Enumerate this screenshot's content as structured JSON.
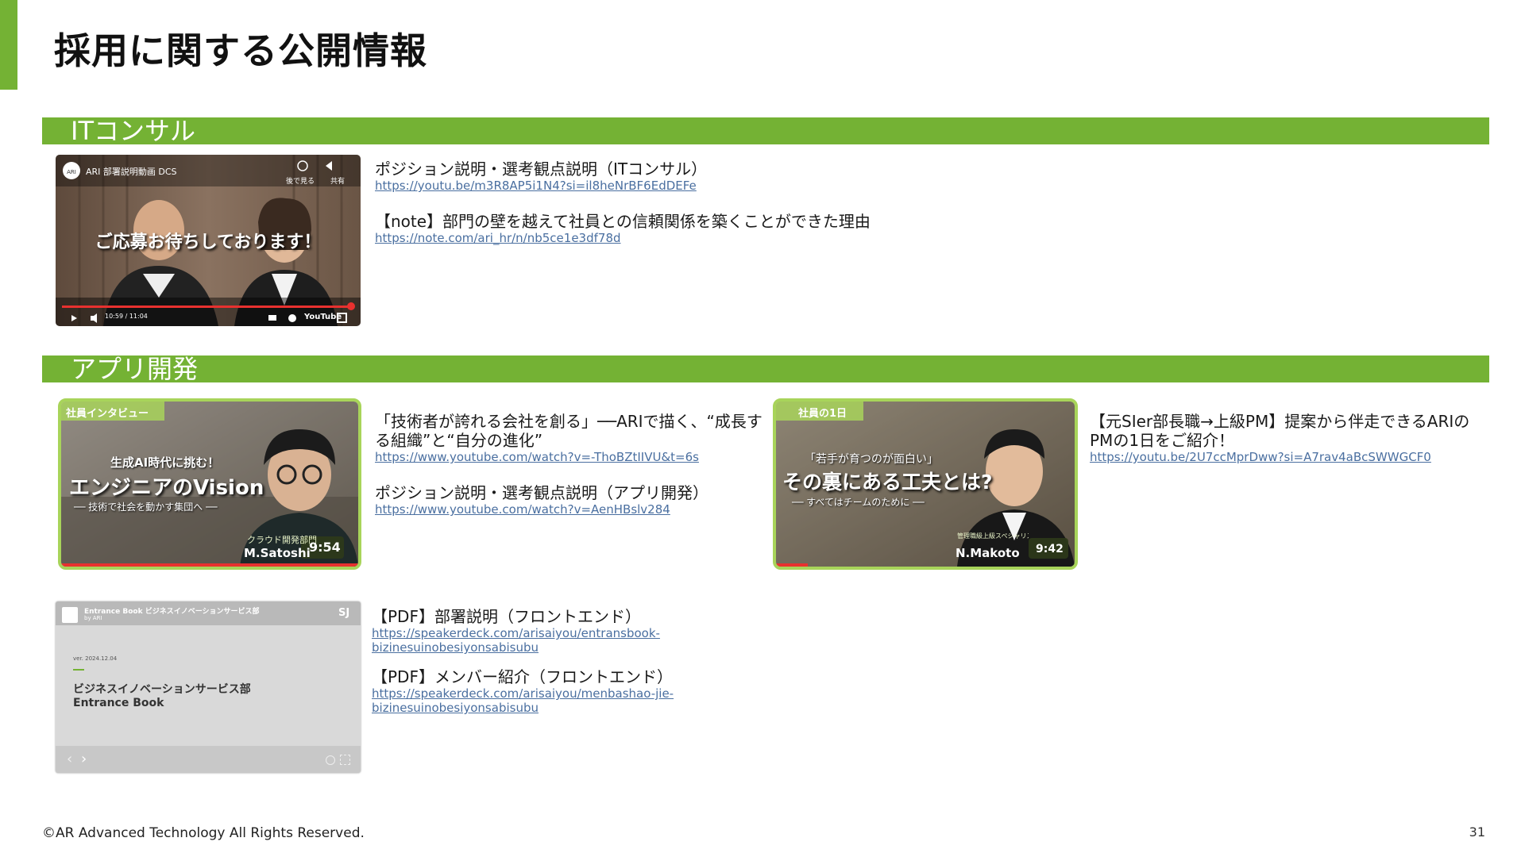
{
  "page": {
    "title": "採用に関する公開情報",
    "footer": "©AR Advanced Technology All Rights Reserved.",
    "page_number": "31"
  },
  "colors": {
    "accent": "#74b234",
    "link": "#4a6fa0"
  },
  "sections": [
    {
      "label": "ITコンサル"
    },
    {
      "label": "アプリ開発"
    }
  ],
  "it_consult": {
    "video": {
      "channel": "ARI 部署説明動画 DCS",
      "watch_later": "後で見る",
      "share": "共有",
      "caption": "ご応募お待ちしております！",
      "time": "10:59 / 11:04",
      "youtube": "YouTube",
      "progress": 0.99
    },
    "links": [
      {
        "title": "ポジション説明・選考観点説明（ITコンサル）",
        "url": "https://youtu.be/m3R8AP5i1N4?si=il8heNrBF6EdDEFe"
      },
      {
        "title": "【note】部門の壁を越えて社員との信頼関係を築くことができた理由",
        "url": "https://note.com/ari_hr/n/nb5ce1e3df78d"
      }
    ]
  },
  "app_dev": {
    "video1": {
      "tag": "社員インタビュー",
      "line1": "生成AI時代に挑む！",
      "line2": "エンジニアのVision",
      "line3": "── 技術で社会を動かす集団へ ──",
      "dept": "クラウド開発部門",
      "name": "M.Satoshi",
      "duration": "9:54"
    },
    "video2": {
      "tag": "社員の1日",
      "line1": "「若手が育つのが面白い」",
      "line2": "その裏にある工夫とは?",
      "line3": "── すべてはチームのために ──",
      "role": "管理職級上級スペシャリスト シニアプロジェクトマネ...",
      "name": "N.Makoto",
      "duration": "9:42"
    },
    "pdf": {
      "header": "Entrance Book ビジネスイノベーションサービス部",
      "by": "by ARI",
      "badge": "SJ",
      "ver": "ver. 2024.12.04",
      "title1": "ビジネスイノベーションサービス部",
      "title2": "Entrance Book"
    },
    "links_col1": [
      {
        "title1": "「技術者が誇れる会社を創る」──ARIで描く、“成長す",
        "title2": "る組織”と“自分の進化”",
        "url": "https://www.youtube.com/watch?v=-ThoBZtIIVU&t=6s"
      },
      {
        "title1": "ポジション説明・選考観点説明（アプリ開発）",
        "url": "https://www.youtube.com/watch?v=AenHBslv284"
      }
    ],
    "links_col2": [
      {
        "title1": "【元SIer部長職→上級PM】提案から伴走できるARIの",
        "title2": "PMの1日をご紹介！",
        "url": "https://youtu.be/2U7ccMprDww?si=A7rav4aBcSWWGCF0"
      }
    ],
    "pdf_links": [
      {
        "title": "【PDF】部署説明（フロントエンド）",
        "url1": "https://speakerdeck.com/arisaiyou/entransbook-",
        "url2": "bizinesuinobesiyonsabisubu"
      },
      {
        "title": "【PDF】メンバー紹介（フロントエンド）",
        "url1": "https://speakerdeck.com/arisaiyou/menbashao-jie-",
        "url2": "bizinesuinobesiyonsabisubu"
      }
    ]
  }
}
